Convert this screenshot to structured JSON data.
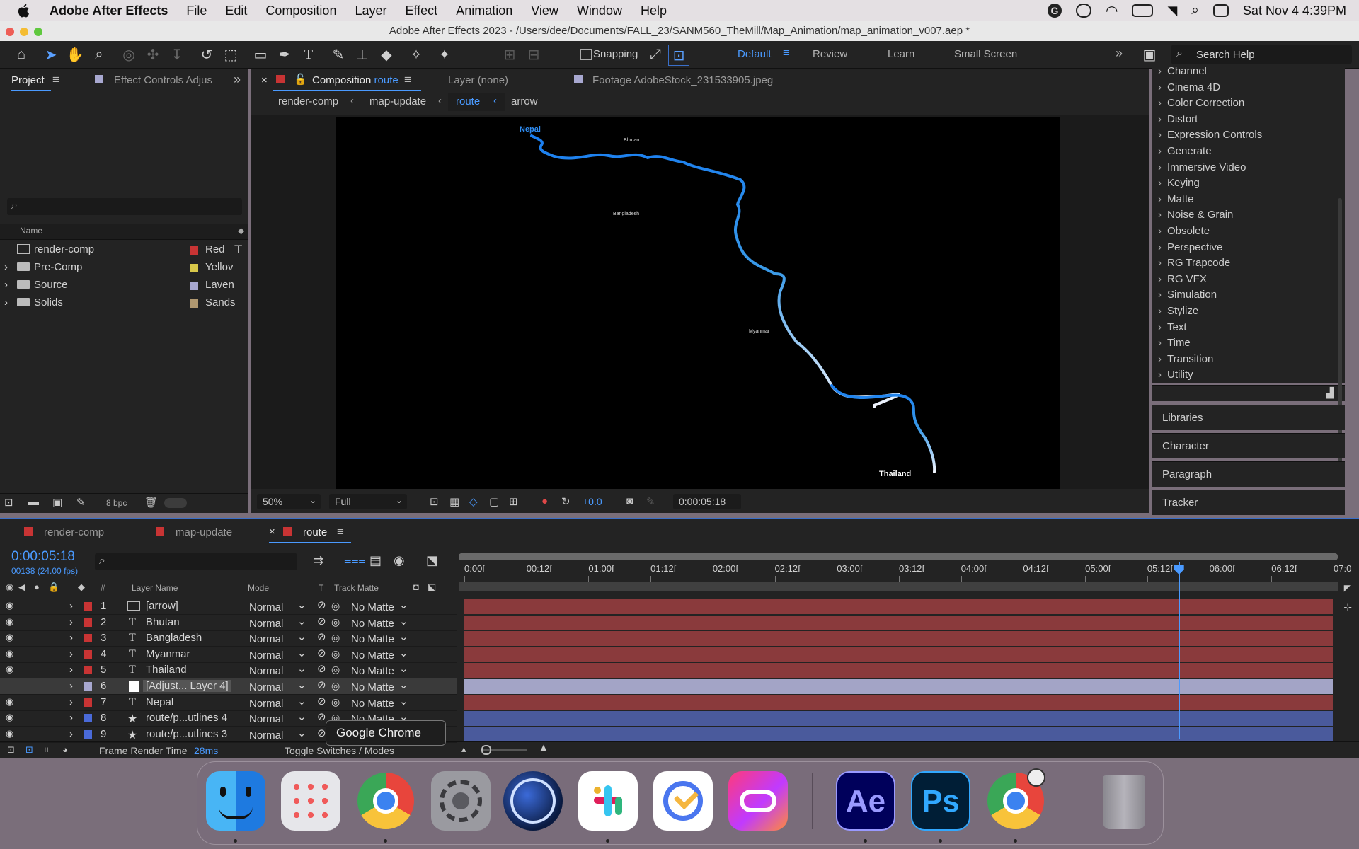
{
  "menubar": {
    "app": "Adobe After Effects",
    "items": [
      "File",
      "Edit",
      "Composition",
      "Layer",
      "Effect",
      "Animation",
      "View",
      "Window",
      "Help"
    ],
    "clock": "Sat Nov 4  4:39PM"
  },
  "window": {
    "title": "Adobe After Effects 2023 - /Users/dee/Documents/FALL_23/SANM560_TheMill/Map_Animation/map_animation_v007.aep *"
  },
  "toolbar": {
    "snapping": "Snapping",
    "workspaces": [
      "Default",
      "Review",
      "Learn",
      "Small Screen"
    ],
    "search_placeholder": "Search Help"
  },
  "project": {
    "tab": "Project",
    "tab2": "Effect Controls Adjus",
    "col_name": "Name",
    "bpc": "8 bpc",
    "items": [
      {
        "name": "render-comp",
        "label": "Red",
        "color": "#c83434"
      },
      {
        "name": "Pre-Comp",
        "label": "Yellov",
        "color": "#d8c84a"
      },
      {
        "name": "Source",
        "label": "Laven",
        "color": "#a8a8d0"
      },
      {
        "name": "Solids",
        "label": "Sands",
        "color": "#b09870"
      }
    ]
  },
  "viewer": {
    "tab_prefix": "Composition",
    "tab_name": "route",
    "layer_tab": "Layer (none)",
    "footage_tab": "Footage AdobeStock_231533905.jpeg",
    "breadcrumbs": [
      "render-comp",
      "map-update",
      "route",
      "arrow"
    ],
    "labels": {
      "nepal": "Nepal",
      "bhutan": "Bhutan",
      "bangladesh": "Bangladesh",
      "myanmar": "Myanmar",
      "thailand": "Thailand"
    },
    "zoom": "50%",
    "resolution": "Full",
    "exposure": "+0.0",
    "timecode": "0:00:05:18"
  },
  "effects": {
    "items": [
      "Channel",
      "Cinema 4D",
      "Color Correction",
      "Distort",
      "Expression Controls",
      "Generate",
      "Immersive Video",
      "Keying",
      "Matte",
      "Noise & Grain",
      "Obsolete",
      "Perspective",
      "RG Trapcode",
      "RG VFX",
      "Simulation",
      "Stylize",
      "Text",
      "Time",
      "Transition",
      "Utility"
    ],
    "panels": [
      "Libraries",
      "Character",
      "Paragraph",
      "Tracker"
    ]
  },
  "timeline": {
    "tabs": [
      {
        "name": "render-comp",
        "color": "#c83434"
      },
      {
        "name": "map-update",
        "color": "#c83434"
      },
      {
        "name": "route",
        "color": "#c83434"
      }
    ],
    "timecode": "0:00:05:18",
    "frames": "00138 (24.00 fps)",
    "headers": {
      "num": "#",
      "layer_name": "Layer Name",
      "mode": "Mode",
      "t": "T",
      "track_matte": "Track Matte"
    },
    "ticks": [
      "0:00f",
      "00:12f",
      "01:00f",
      "01:12f",
      "02:00f",
      "02:12f",
      "03:00f",
      "03:12f",
      "04:00f",
      "04:12f",
      "05:00f",
      "05:12f",
      "06:00f",
      "06:12f",
      "07:0"
    ],
    "playhead_sec": 5.75,
    "timeline_end_sec": 7.0,
    "layers": [
      {
        "num": "1",
        "icon": "comp",
        "name": "[arrow]",
        "mode": "Normal",
        "matte": "No Matte",
        "color": "#c83434",
        "bar": "#8a3a3c"
      },
      {
        "num": "2",
        "icon": "T",
        "name": "Bhutan",
        "mode": "Normal",
        "matte": "No Matte",
        "color": "#c83434",
        "bar": "#8a3a3c"
      },
      {
        "num": "3",
        "icon": "T",
        "name": "Bangladesh",
        "mode": "Normal",
        "matte": "No Matte",
        "color": "#c83434",
        "bar": "#8a3a3c"
      },
      {
        "num": "4",
        "icon": "T",
        "name": "Myanmar",
        "mode": "Normal",
        "matte": "No Matte",
        "color": "#c83434",
        "bar": "#8a3a3c"
      },
      {
        "num": "5",
        "icon": "T",
        "name": "Thailand",
        "mode": "Normal",
        "matte": "No Matte",
        "color": "#c83434",
        "bar": "#8a3a3c"
      },
      {
        "num": "6",
        "icon": "solid",
        "name": "[Adjust... Layer 4]",
        "mode": "Normal",
        "matte": "No Matte",
        "color": "#a8a8d0",
        "bar": "#a3a4c6"
      },
      {
        "num": "7",
        "icon": "T",
        "name": "Nepal",
        "mode": "Normal",
        "matte": "No Matte",
        "color": "#c83434",
        "bar": "#8a3a3c"
      },
      {
        "num": "8",
        "icon": "star",
        "name": "route/p...utlines 4",
        "mode": "Normal",
        "matte": "No Matte",
        "color": "#4a6ad8",
        "bar": "#4a5a9c"
      },
      {
        "num": "9",
        "icon": "star",
        "name": "route/p...utlines 3",
        "mode": "Normal",
        "matte": "No Matte",
        "color": "#4a6ad8",
        "bar": "#4a5a9c"
      }
    ],
    "render_label": "Frame Render Time",
    "render_value": "28ms",
    "toggle": "Toggle Switches / Modes",
    "tooltip": "Google Chrome"
  },
  "dock": {
    "apps": [
      "finder",
      "launchpad",
      "chrome",
      "system-settings",
      "cinema4d",
      "slack",
      "ticktick",
      "creative-cloud",
      "after-effects",
      "photoshop",
      "chrome-2",
      "trash"
    ],
    "ae": "Ae",
    "ps": "Ps"
  }
}
